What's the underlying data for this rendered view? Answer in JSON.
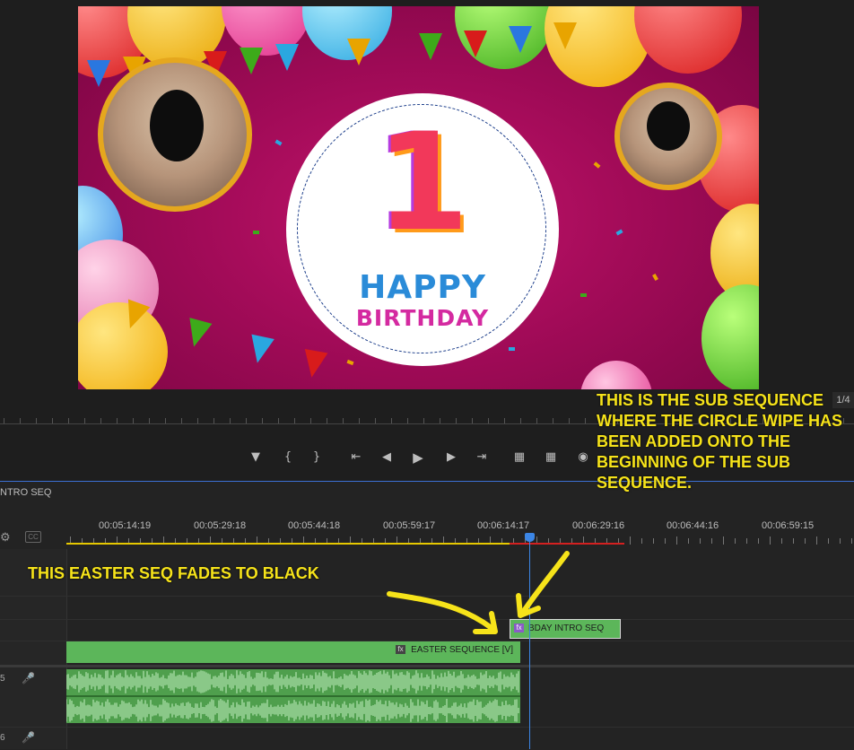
{
  "program_monitor": {
    "frame": {
      "happy_text": "HAPPY",
      "birthday_text": "BIRTHDAY",
      "numeral": "1"
    },
    "page_indicator": "1/4",
    "transport": {
      "add_marker": "marker-icon",
      "mark_in": "{",
      "mark_out": "}",
      "go_to_in": "go-to-in-icon",
      "step_back": "step-back-icon",
      "play": "play-icon",
      "step_forward": "step-forward-icon",
      "go_to_out": "go-to-out-icon",
      "lift": "lift-icon",
      "extract": "extract-icon",
      "export_frame": "camera-icon"
    }
  },
  "timeline": {
    "sequence_tab": "NTRO SEQ",
    "timecodes": [
      "00:05:14:19",
      "00:05:29:18",
      "00:05:44:18",
      "00:05:59:17",
      "00:06:14:17",
      "00:06:29:16",
      "00:06:44:16",
      "00:06:59:15"
    ],
    "clips": {
      "bday": "BDAY INTRO SEQ",
      "easter": "EASTER SEQUENCE [V]"
    },
    "track_numbers": [
      "5",
      "6"
    ],
    "captions_label": "CC"
  },
  "annotations": {
    "sub_sequence_note": "THIS IS THE SUB SEQUENCE WHERE THE CIRCLE WIPE HAS BEEN ADDED ONTO THE BEGINNING OF THE SUB SEQUENCE.",
    "easter_note": "THIS EASTER SEQ FADES TO BLACK"
  },
  "colors": {
    "clip_green": "#5cb65a",
    "playhead_blue": "#3c86e6",
    "annotation_yellow": "#f6e31a",
    "work_area_yellow": "#e6c800",
    "render_red": "#d42020"
  }
}
